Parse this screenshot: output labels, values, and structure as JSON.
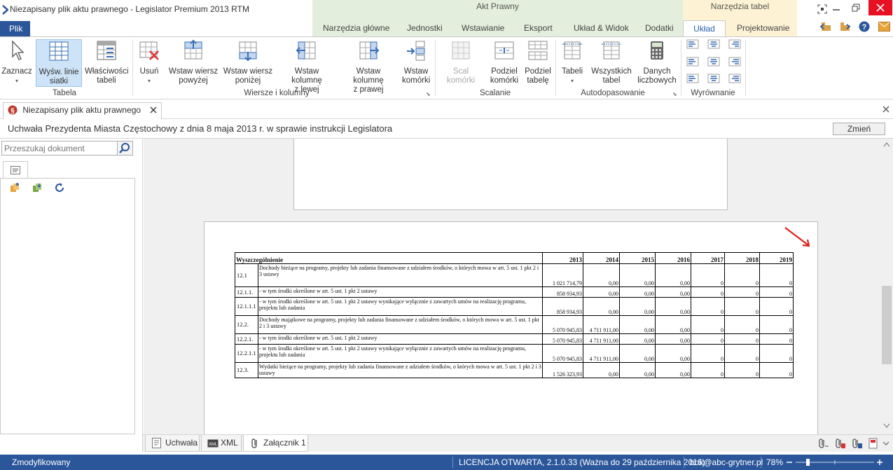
{
  "window": {
    "title": "Niezapisany plik aktu prawnego - Legislator Premium 2013 RTM"
  },
  "context_groups": {
    "akt_prawny": "Akt Prawny",
    "narzedzia_tabel": "Narzędzia tabel"
  },
  "menu": {
    "file": "Plik",
    "tabs": [
      "Narzędzia główne",
      "Jednostki",
      "Wstawianie",
      "Eksport",
      "Układ & Widok",
      "Dodatki",
      "Układ",
      "Projektowanie"
    ]
  },
  "ribbon": {
    "tabela": {
      "zaznacz": "Zaznacz",
      "wysw_line1": "Wyśw. linie",
      "wysw_line2": "siatki",
      "wlasc_line1": "Właściwości",
      "wlasc_line2": "tabeli",
      "label": "Tabela"
    },
    "wiersze": {
      "usun": "Usuń",
      "wstaw_wiersz_pow_1": "Wstaw wiersz",
      "wstaw_wiersz_pow_2": "powyżej",
      "wstaw_wiersz_pon_1": "Wstaw wiersz",
      "wstaw_wiersz_pon_2": "poniżej",
      "wstaw_kol_lewa_1": "Wstaw kolumnę",
      "wstaw_kol_lewa_2": "z lewej",
      "wstaw_kol_prawa_1": "Wstaw kolumnę",
      "wstaw_kol_prawa_2": "z prawej",
      "wstaw_kom_1": "Wstaw",
      "wstaw_kom_2": "komórki",
      "label": "Wiersze i kolumny"
    },
    "scalanie": {
      "scal": "Scal komórki",
      "podziel_kom_1": "Podziel",
      "podziel_kom_2": "komórki",
      "podziel_tab_1": "Podziel",
      "podziel_tab_2": "tabelę",
      "label": "Scalanie"
    },
    "autodopasowanie": {
      "tabeli": "Tabeli",
      "wszystkich_1": "Wszystkich",
      "wszystkich_2": "tabel",
      "danych_1": "Danych",
      "danych_2": "liczbowych",
      "label": "Autodopasowanie"
    },
    "wyrownanie": {
      "label": "Wyrównanie"
    }
  },
  "doc_tab": {
    "label": "Niezapisany plik aktu prawnego"
  },
  "info": {
    "title": "Uchwała Prezydenta Miasta Częstochowy z dnia 8 maja 2013 r. w sprawie instrukcji Legislatora",
    "change_button": "Zmień"
  },
  "search": {
    "placeholder": "Przeszukaj dokument"
  },
  "table": {
    "header": [
      "Wyszczególnienie",
      "2013",
      "2014",
      "2015",
      "2016",
      "2017",
      "2018",
      "2019"
    ],
    "rows": [
      {
        "lp": "12.1",
        "desc": "Dochody bieżące na programy, projekty lub zadania finansowane z udziałem środków, o których mowa w art. 5 ust. 1 pkt 2 i 3 ustawy",
        "values": [
          "1 021 714,79",
          "0,00",
          "0,00",
          "0,00",
          "0",
          "0",
          "0"
        ]
      },
      {
        "lp": "12.1.1.",
        "desc": "- w tym środki określone w art. 5 ust. 1 pkt 2 ustawy",
        "values": [
          "858 934,93",
          "0,00",
          "0,00",
          "0,00",
          "0",
          "0",
          "0"
        ]
      },
      {
        "lp": "12.1.1.1",
        "desc": "- w tym środki określone w art. 5 ust. 1 pkt 2 ustawy wynikające wyłącznie z zawartych umów na realizację programu, projektu lub zadania",
        "values": [
          "858 934,93",
          "0,00",
          "0,00",
          "0,00",
          "0",
          "0",
          "0"
        ]
      },
      {
        "lp": "12.2.",
        "desc": "Dochody majątkowe na programy, projekty lub zadania finansowane z udziałem środków, o których mowa w art. 5 ust. 1 pkt 2 i 3 ustawy",
        "values": [
          "5 070 945,83",
          "4 711 911,00",
          "0,00",
          "0,00",
          "0",
          "0",
          "0"
        ]
      },
      {
        "lp": "12.2.1.",
        "desc": "- w tym środki określone w art. 5 ust. 1 pkt 2 ustawy",
        "values": [
          "5 070 945,83",
          "4 711 911,00",
          "0,00",
          "0,00",
          "0",
          "0",
          "0"
        ]
      },
      {
        "lp": "12.2.1.1",
        "desc": "- w tym środki określone w art. 5 ust. 1 pkt 2 ustawy wynikające wyłącznie z zawartych umów na realizację programu, projektu lub zadania",
        "values": [
          "5 070 945,83",
          "4 711 911,00",
          "0,00",
          "0,00",
          "0",
          "0",
          "0"
        ]
      },
      {
        "lp": "12.3.",
        "desc": "Wydatki bieżące na programy, projekty lub zadania finansowane z udziałem środków, o których mowa w art. 5 ust. 1 pkt 2 i 3 ustawy",
        "values": [
          "1 526 323,93",
          "0,00",
          "0,00",
          "0,00",
          "0",
          "0",
          "0"
        ]
      }
    ]
  },
  "bottom_tabs": [
    "Uchwała",
    "XML",
    "Załącznik 1"
  ],
  "status": {
    "left": "Zmodyfikowany",
    "license": "LICENCJA OTWARTA, 2.1.0.33 (Ważna do 29 października 2016)",
    "email": "bok@abc-grytner.pl",
    "zoom": "78%"
  },
  "colors": {
    "accent": "#2b579a",
    "context_green": "#e3efdc",
    "context_yellow": "#fdf3d4",
    "selected_button": "#cde3f7",
    "arrow_red": "#e0201b"
  }
}
